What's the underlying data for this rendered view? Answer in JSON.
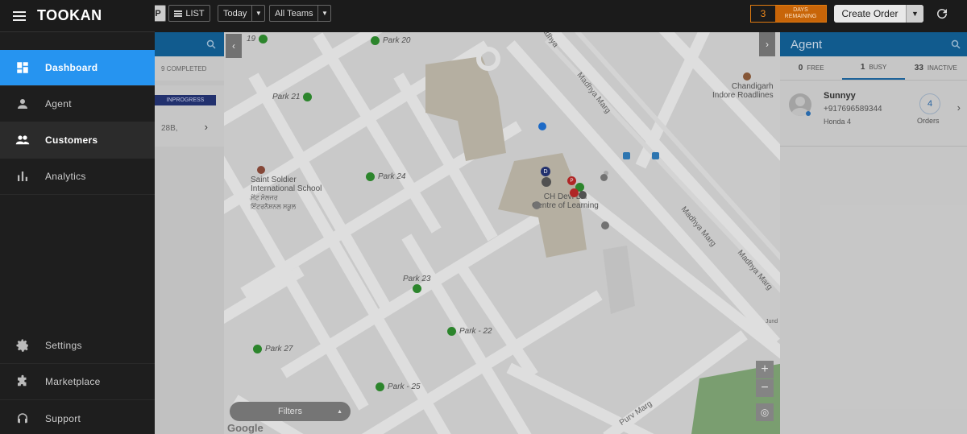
{
  "app": {
    "brand": "TOOKAN"
  },
  "topbar": {
    "map_label": "P",
    "list_label": "LIST",
    "date_filter": "Today",
    "team_filter": "All Teams",
    "trial_days": "3",
    "trial_text": "DAYS REMAINING",
    "create_order": "Create Order"
  },
  "sidebar": {
    "items": [
      {
        "label": "Dashboard",
        "icon": "dashboard-icon"
      },
      {
        "label": "Agent",
        "icon": "person-icon"
      },
      {
        "label": "Customers",
        "icon": "people-icon"
      },
      {
        "label": "Analytics",
        "icon": "bar-chart-icon"
      },
      {
        "label": "Settings",
        "icon": "gear-icon"
      },
      {
        "label": "Marketplace",
        "icon": "puzzle-icon"
      },
      {
        "label": "Support",
        "icon": "headset-icon"
      }
    ]
  },
  "tasks": {
    "completed_tab": "9 COMPLETED",
    "status_badge": "INPROGRESS",
    "address": "28B,"
  },
  "map": {
    "places": [
      {
        "name": "19"
      },
      {
        "name": "Park 20"
      },
      {
        "name": "Park 21"
      },
      {
        "name": "Park 24"
      },
      {
        "name": "Park 23"
      },
      {
        "name": "Park - 22"
      },
      {
        "name": "Park 27"
      },
      {
        "name": "Park - 25"
      }
    ],
    "school_line1": "Saint Soldier",
    "school_line2": "International School",
    "school_line3": "ਸੇਂਟ ਸੋਲਜਰ",
    "school_line4": "ਇੰਟਰਨੈਸ਼ਨਲ ਸਕੂਲ",
    "college_line1": "CH Devi Lal",
    "college_line2": "Centre of Learning",
    "rest_line1": "Chandigarh",
    "rest_line2": "Indore Roadlines",
    "road1": "Madhya Marg",
    "road2": "Madhya Marg",
    "road3": "Madhya Marg",
    "road4": "Purv Marg",
    "road5": "Madhya",
    "road6": "Jund",
    "filters": "Filters",
    "google": "Google"
  },
  "agents": {
    "title": "Agent",
    "tabs": [
      {
        "count": "0",
        "label": "FREE"
      },
      {
        "count": "1",
        "label": "BUSY"
      },
      {
        "count": "33",
        "label": "INACTIVE"
      }
    ],
    "list": [
      {
        "name": "Sunnyy",
        "phone": "+917696589344",
        "vehicle": "Honda 4",
        "orders_count": "4",
        "orders_label": "Orders"
      }
    ]
  }
}
